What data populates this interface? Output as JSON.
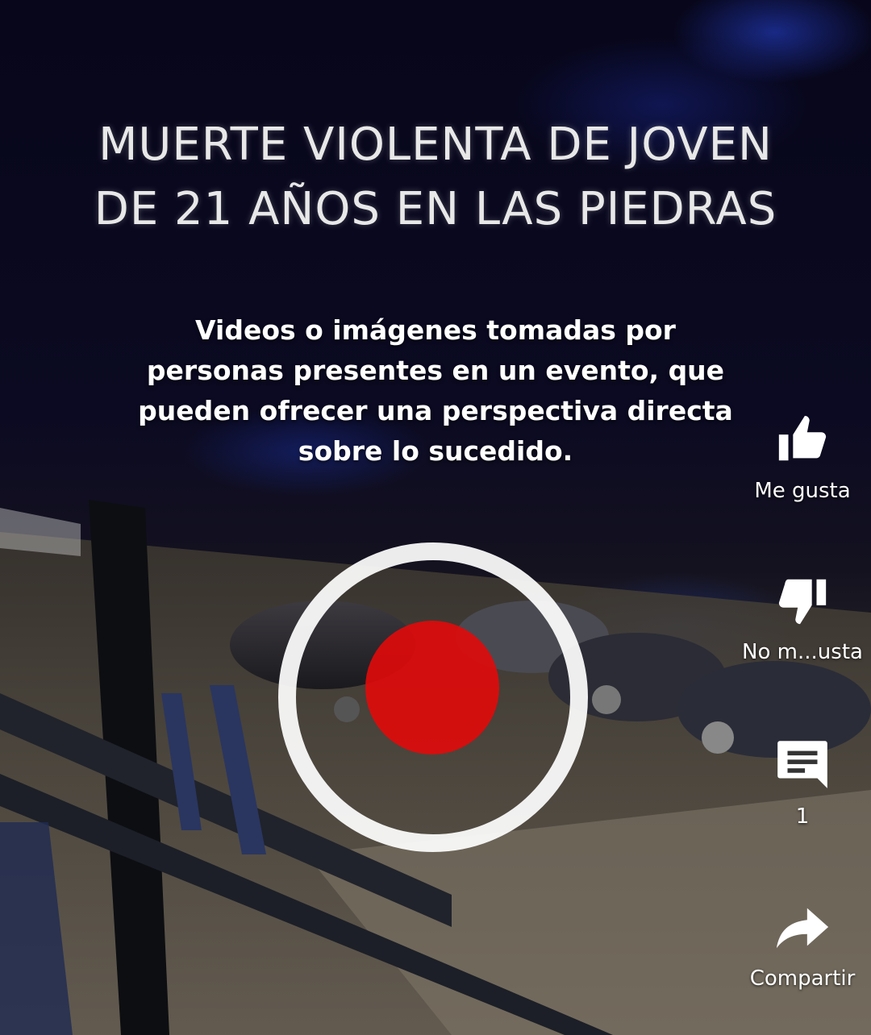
{
  "video": {
    "headline": "MUERTE VIOLENTA DE JOVEN DE 21 AÑOS  EN LAS PIEDRAS",
    "caption": "Videos o imágenes tomadas por personas presentes en un evento, que pueden ofrecer una perspectiva directa sobre lo sucedido."
  },
  "actions": {
    "like": {
      "label": "Me gusta",
      "icon": "thumbs-up-icon"
    },
    "dislike": {
      "label": "No m...usta",
      "icon": "thumbs-down-icon"
    },
    "comments": {
      "count": "1",
      "icon": "comment-icon"
    },
    "share": {
      "label": "Compartir",
      "icon": "share-icon"
    }
  },
  "colors": {
    "highlight_ring": "#ffffff",
    "highlight_dot": "#e20a0a",
    "icon": "#ffffff"
  }
}
